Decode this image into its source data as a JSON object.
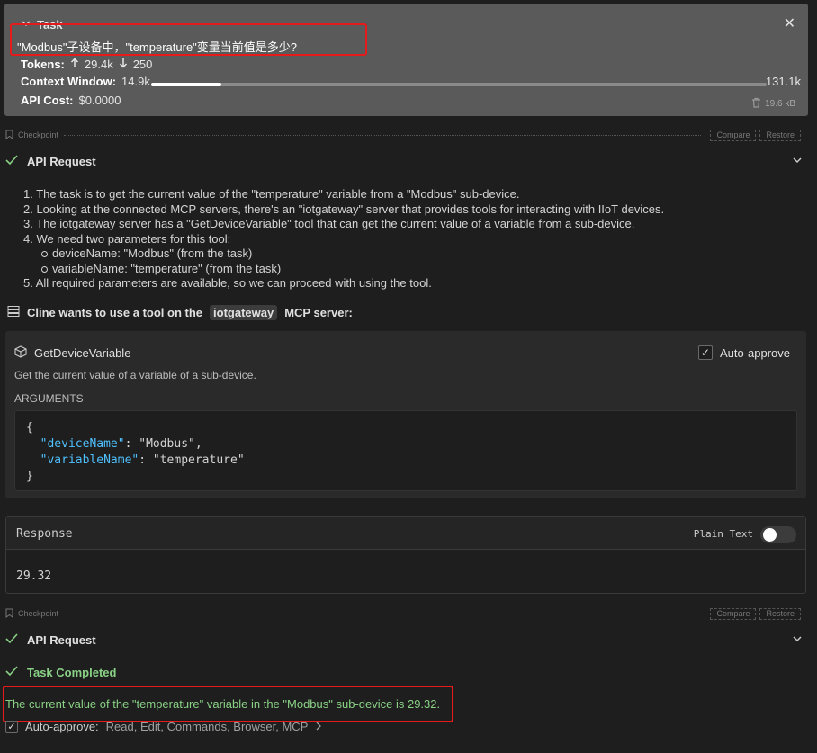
{
  "task": {
    "title": "Task",
    "question": "\"Modbus\"子设备中，\"temperature\"变量当前值是多少?",
    "tokens_label": "Tokens:",
    "tokens_in": "29.4k",
    "tokens_out": "250",
    "context_label": "Context Window:",
    "context_used": "14.9k",
    "context_max": "131.1k",
    "context_fraction": 0.114,
    "cost_label": "API Cost:",
    "cost_value": "$0.0000",
    "size": "19.6 kB"
  },
  "checkpoint": {
    "label": "Checkpoint",
    "compare": "Compare",
    "restore": "Restore"
  },
  "api_request_label": "API Request",
  "reasoning": [
    "1. The task is to get the current value of the \"temperature\" variable from a \"Modbus\" sub-device.",
    "2. Looking at the connected MCP servers, there's an \"iotgateway\" server that provides tools for interacting with IIoT devices.",
    "3. The iotgateway server has a \"GetDeviceVariable\" tool that can get the current value of a variable from a sub-device.",
    "4. We need two parameters for this tool:",
    "deviceName: \"Modbus\" (from the task)",
    "variableName: \"temperature\" (from the task)",
    "5. All required parameters are available, so we can proceed with using the tool."
  ],
  "tool_use": {
    "prefix": "Cline wants to use a tool on the",
    "server": "iotgateway",
    "suffix": "MCP server:",
    "tool_name": "GetDeviceVariable",
    "auto_approve": "Auto-approve",
    "description": "Get the current value of a variable of a sub-device.",
    "args_label": "ARGUMENTS",
    "args": [
      {
        "key": "deviceName",
        "value": "Modbus"
      },
      {
        "key": "variableName",
        "value": "temperature"
      }
    ]
  },
  "response": {
    "title": "Response",
    "plain_text_label": "Plain Text",
    "value": "29.32"
  },
  "completion": {
    "label": "Task Completed",
    "text": "The current value of the \"temperature\" variable in the \"Modbus\" sub-device is 29.32."
  },
  "footer": {
    "label": "Auto-approve:",
    "options": "Read, Edit, Commands, Browser, MCP"
  },
  "colors": {
    "accent_green": "#89d185",
    "highlight_red": "#e51b1b",
    "json_key": "#4fc1ff"
  }
}
